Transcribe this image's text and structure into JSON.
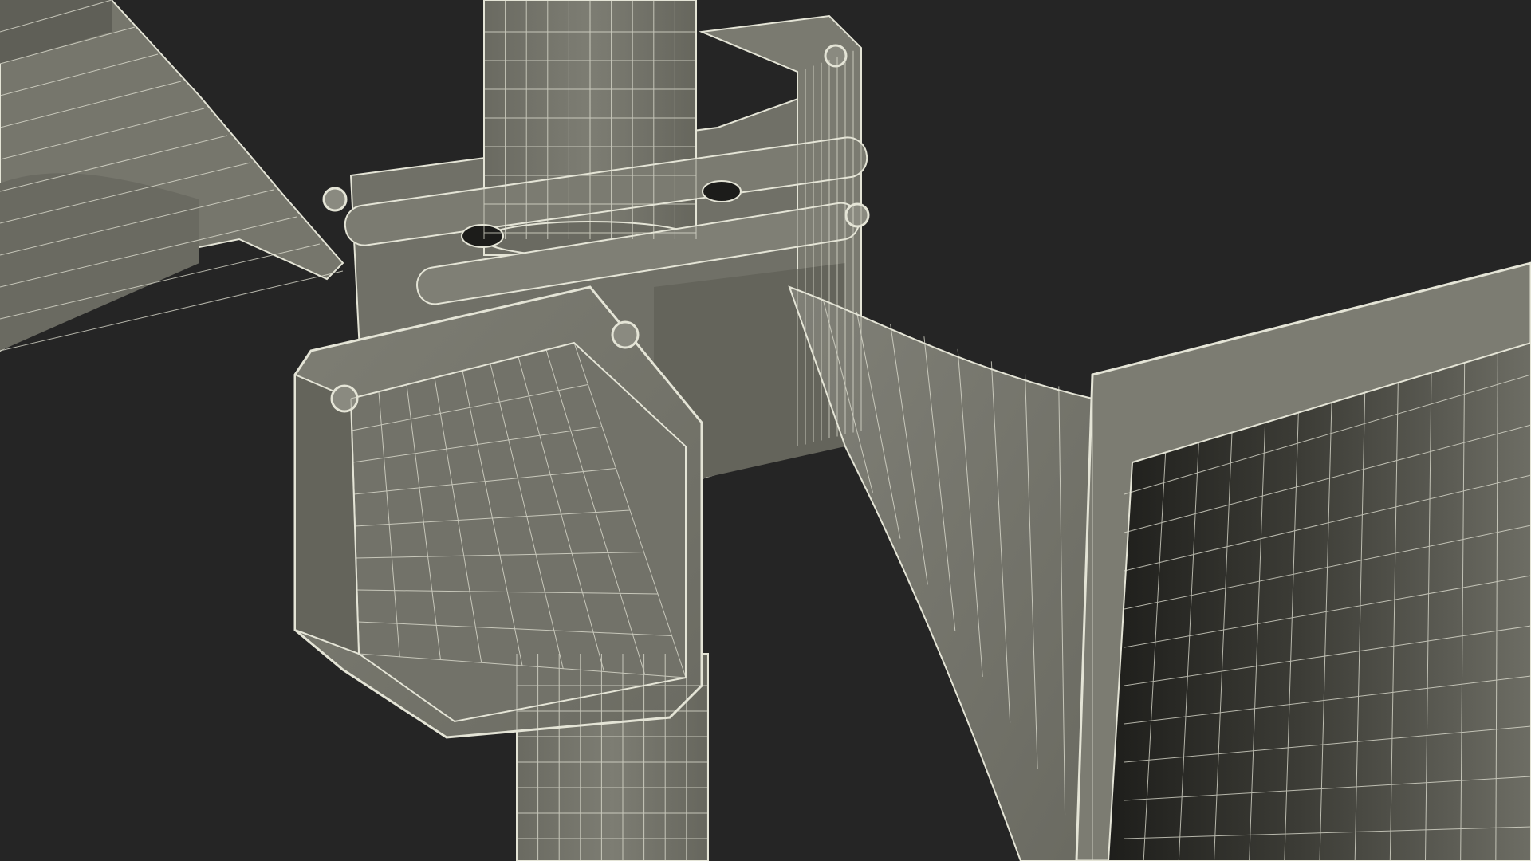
{
  "scene": {
    "subject": "wireframe-render",
    "colors": {
      "background": "#252525",
      "surface_light": "#8a8a80",
      "surface_mid": "#77776d",
      "surface_dark": "#5e5e55",
      "surface_shadow": "#3c3c36",
      "wire": "#e4e4d6",
      "wire_dim": "#b9b9ab"
    }
  }
}
